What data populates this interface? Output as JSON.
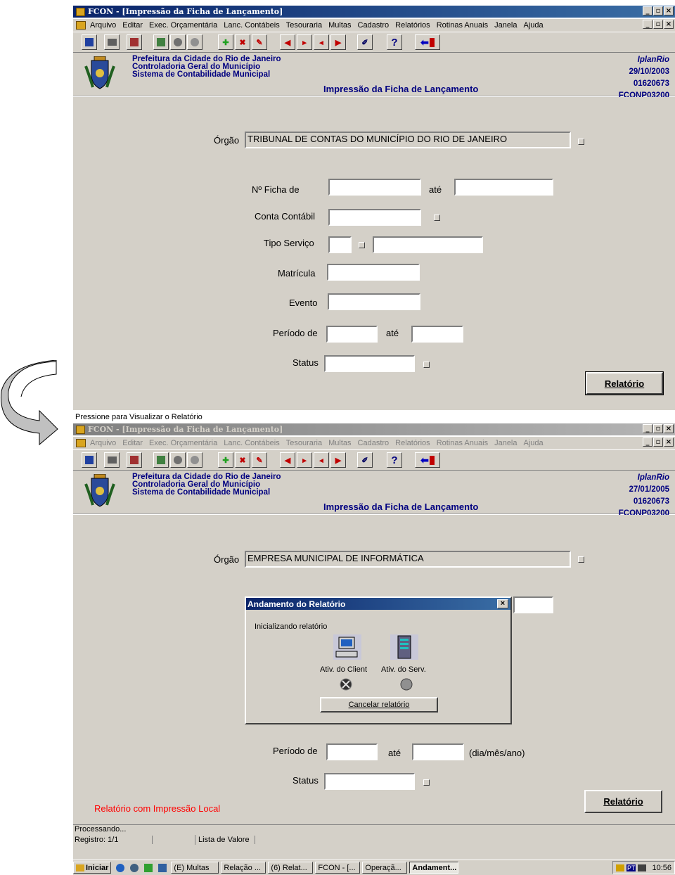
{
  "window1": {
    "title": "FCON - [Impressão da Ficha de Lançamento]",
    "menu": [
      "Arquivo",
      "Editar",
      "Exec. Orçamentária",
      "Lanc. Contábeis",
      "Tesouraria",
      "Multas",
      "Cadastro",
      "Relatórios",
      "Rotinas Anuais",
      "Janela",
      "Ajuda"
    ],
    "header": {
      "org1": "Prefeitura da Cidade do Rio de Janeiro",
      "org2": "Controladoria Geral do Município",
      "org3": "Sistema de Contabilidade Municipal",
      "company": "IplanRio",
      "date": "29/10/2003",
      "code": "01620673",
      "program": "FCONP03200",
      "screen_title": "Impressão  da Ficha de Lançamento"
    },
    "form": {
      "orgao_label": "Órgão",
      "orgao_value": "TRIBUNAL DE CONTAS DO MUNICÍPIO DO RIO DE JANEIRO",
      "ficha_label": "Nº Ficha de",
      "ate_label": "até",
      "conta_label": "Conta Contábil",
      "tipo_label": "Tipo Serviço",
      "matricula_label": "Matrícula",
      "evento_label": "Evento",
      "periodo_label": "Período de",
      "periodo_ate": "até",
      "status_label": "Status",
      "relatorio_button": "Relatório"
    }
  },
  "hint_text": "Pressione para Visualizar o Relatório",
  "window2": {
    "title": "FCON - [Impressão da Ficha de Lançamento]",
    "menu": [
      "Arquivo",
      "Editar",
      "Exec. Orçamentária",
      "Lanc. Contábeis",
      "Tesouraria",
      "Multas",
      "Cadastro",
      "Relatórios",
      "Rotinas Anuais",
      "Janela",
      "Ajuda"
    ],
    "header": {
      "org1": "Prefeitura da Cidade do Rio de Janeiro",
      "org2": "Controladoria Geral do Município",
      "org3": "Sistema de Contabilidade Municipal",
      "company": "IplanRio",
      "date": "27/01/2005",
      "code": "01620673",
      "program": "FCONP03200",
      "screen_title": "Impressão  da Ficha de Lançamento"
    },
    "form": {
      "orgao_label": "Órgão",
      "orgao_value": "EMPRESA MUNICIPAL DE INFORMÁTICA",
      "periodo_label": "Período de",
      "periodo_ate": "até",
      "periodo_hint": "(dia/mês/ano)",
      "status_label": "Status",
      "local_print": "Relatório com Impressão Local",
      "relatorio_button": "Relatório"
    },
    "dialog": {
      "title": "Andamento do Relatório",
      "message": "Inicializando relatório",
      "client_label": "Ativ. do Client",
      "server_label": "Ativ. do Serv.",
      "cancel_button": "Cancelar relatório"
    },
    "statusbar": {
      "line1": "Processando...",
      "record": "Registro: 1/1",
      "lov": "Lista de Valore"
    }
  },
  "taskbar": {
    "start": "Iniciar",
    "tasks": [
      "(E) Multas",
      "Relação ...",
      "(6) Relat...",
      "FCON - [...",
      "Operaçã...",
      "Andament..."
    ],
    "lang": "PT",
    "clock": "10:56"
  },
  "colors": {
    "face": "#d4d0c8",
    "title_active": "#0a246a",
    "header_text": "#000080",
    "warning_text": "#ff0000"
  }
}
